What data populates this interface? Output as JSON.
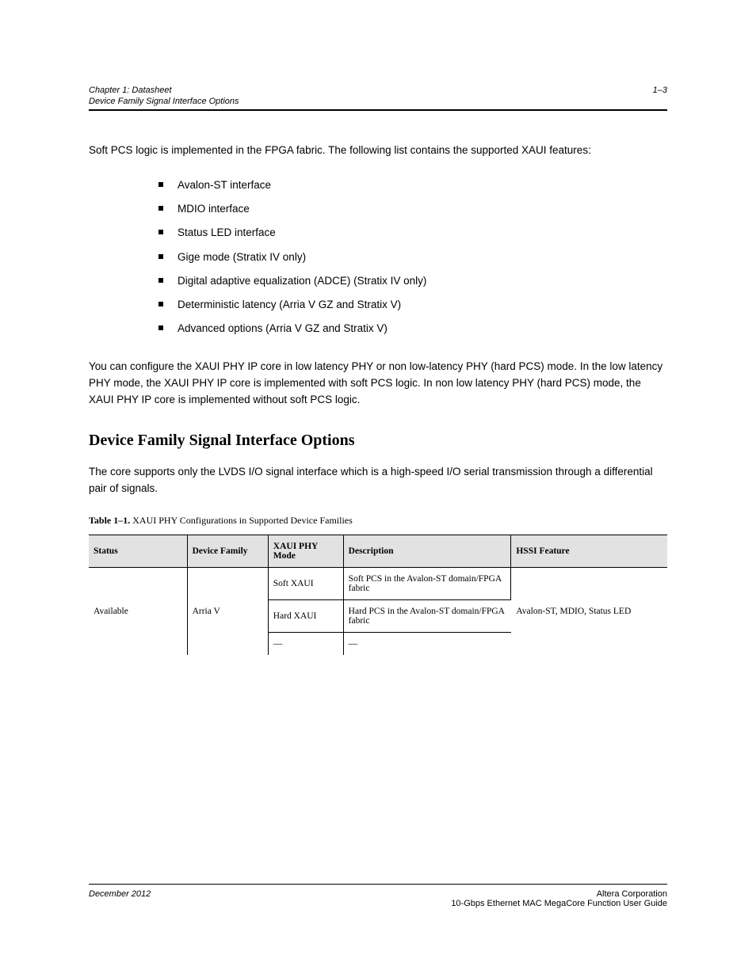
{
  "header": {
    "section": "Chapter 1: Datasheet",
    "subsection": "Device Family Signal Interface Options"
  },
  "intro": "Soft PCS logic is implemented in the FPGA fabric. The following list contains the supported XAUI features:",
  "bullets": [
    "Avalon-ST interface",
    "MDIO interface",
    "Status LED interface",
    "Gige mode (Stratix IV only)",
    "Digital adaptive equalization (ADCE) (Stratix IV only)",
    "Deterministic latency (Arria V GZ and Stratix V)",
    "Advanced options (Arria V GZ and Stratix V)"
  ],
  "para_lowlatency": "You can configure the XAUI PHY IP core in low latency PHY or non low-latency PHY (hard PCS) mode. In the low latency PHY mode, the XAUI PHY IP core is implemented with soft PCS logic. In non low latency PHY (hard PCS) mode, the XAUI PHY IP core is implemented without soft PCS logic.",
  "section_title": "Device Family Signal Interface Options",
  "para_signal": "The core supports only the LVDS I/O signal interface which is a high-speed I/O serial transmission through a differential pair of signals.",
  "table": {
    "caption_label": "Table 1–1.",
    "caption": "XAUI PHY Configurations in Supported Device Families",
    "columns": [
      "Status",
      "Device Family",
      "XAUI PHY Mode",
      "Description",
      "HSSI Feature"
    ],
    "rows": [
      {
        "status": "Available",
        "device": "Arria V",
        "mode": "Soft XAUI",
        "desc": "Soft PCS in the Avalon-ST domain/FPGA fabric",
        "hssi": "Avalon-ST, MDIO, Status LED"
      },
      {
        "status": "",
        "device": "",
        "mode": "Hard XAUI",
        "desc": "Hard PCS in the Avalon-ST domain/FPGA fabric",
        "hssi": ""
      },
      {
        "status": "",
        "device": "",
        "mode": "—",
        "desc": "—",
        "hssi": ""
      }
    ]
  },
  "footer": {
    "date": "December 2012",
    "company": "Altera Corporation",
    "product": "10-Gbps Ethernet MAC MegaCore Function User Guide",
    "page": "1–3"
  }
}
